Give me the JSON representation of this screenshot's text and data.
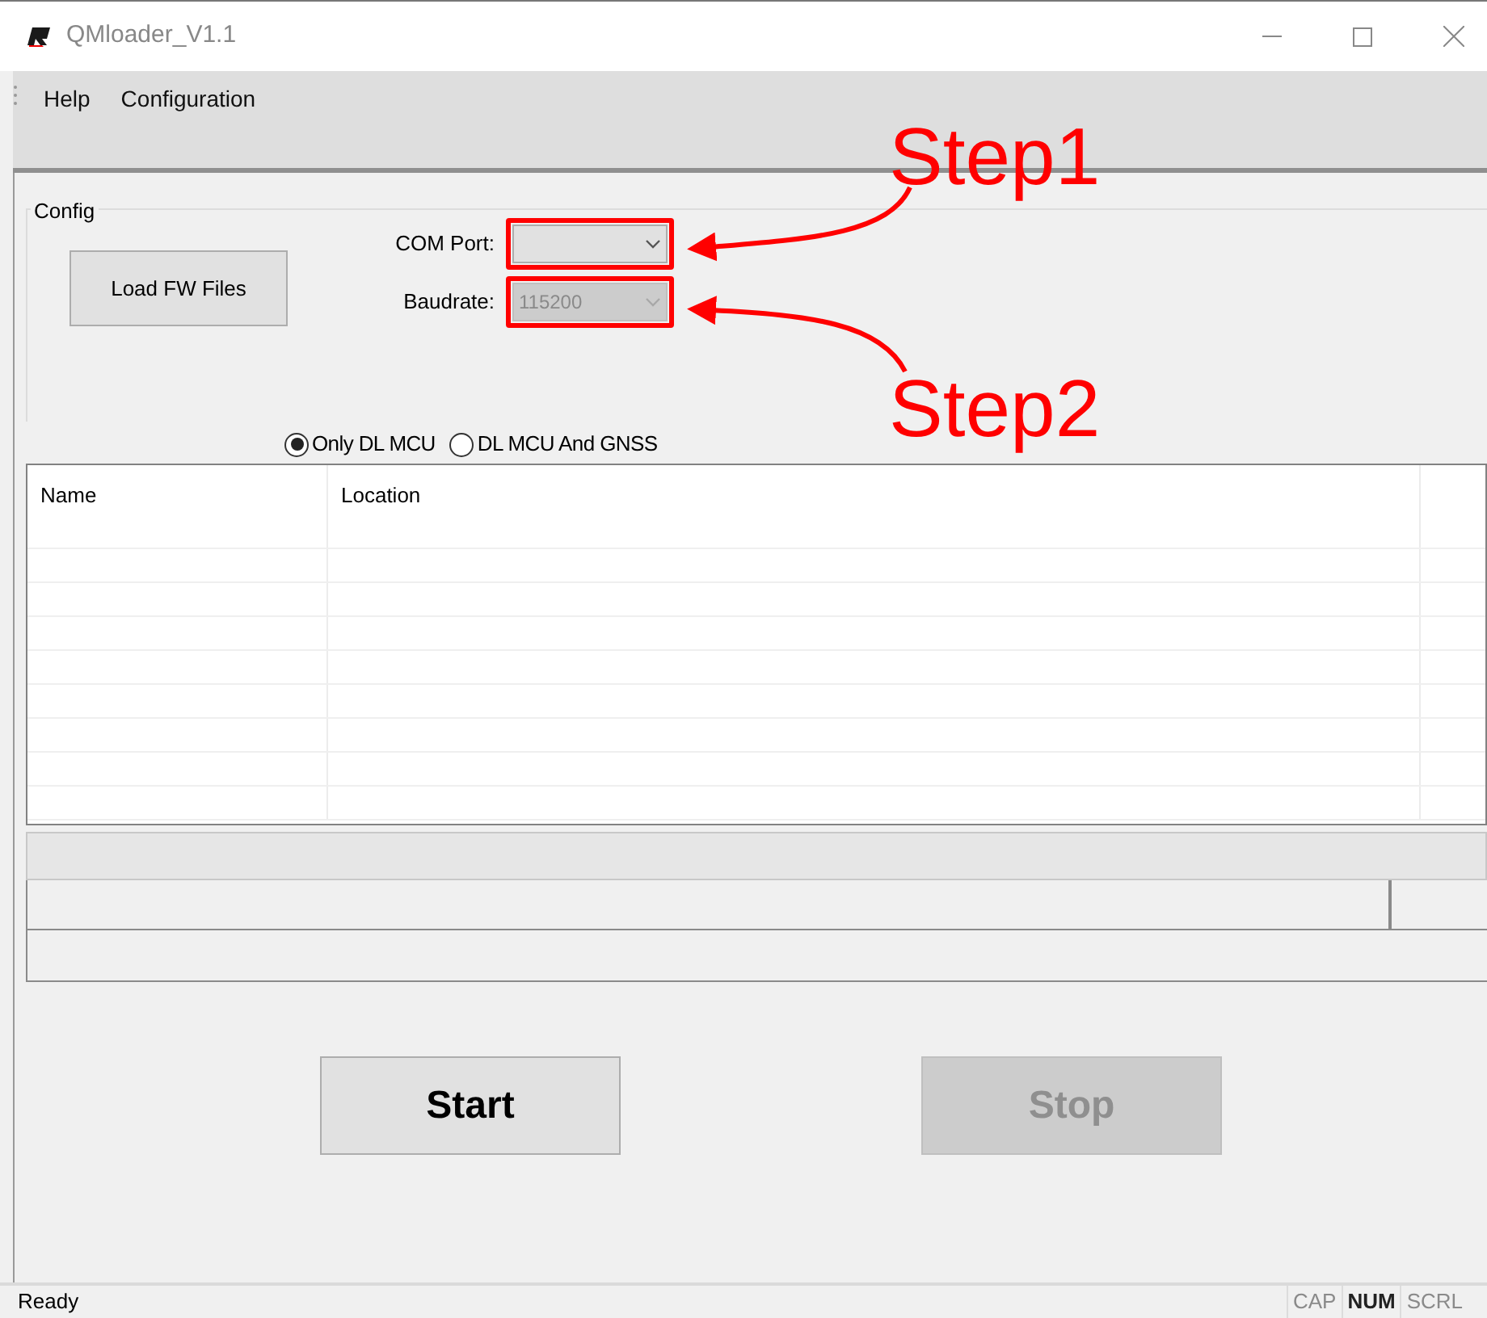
{
  "window": {
    "title": "QMloader_V1.1"
  },
  "menu": [
    {
      "label": "Help"
    },
    {
      "label": "Configuration"
    }
  ],
  "config": {
    "title": "Config",
    "load_button": "Load FW Files",
    "fields": [
      {
        "label": "COM Port:",
        "disabled": false,
        "highlighted": true
      },
      {
        "label": "Baudrate:",
        "value": "115200",
        "disabled": true,
        "highlighted": true
      }
    ],
    "modes": [
      {
        "label": "Only DL MCU",
        "selected": true
      },
      {
        "label": "DL MCU And GNSS",
        "selected": false
      }
    ]
  },
  "table": {
    "columns": [
      "Name",
      "Location"
    ]
  },
  "buttons": [
    {
      "label": "Start",
      "disabled": false
    },
    {
      "label": "Stop",
      "disabled": true
    }
  ],
  "status_bar": {
    "text": "Ready",
    "indicators": [
      {
        "label": "CAP",
        "on": false
      },
      {
        "label": "NUM",
        "on": true
      },
      {
        "label": "SCRL",
        "on": false
      }
    ]
  },
  "annotations": [
    {
      "text": "Step1"
    },
    {
      "text": "Step2"
    }
  ]
}
